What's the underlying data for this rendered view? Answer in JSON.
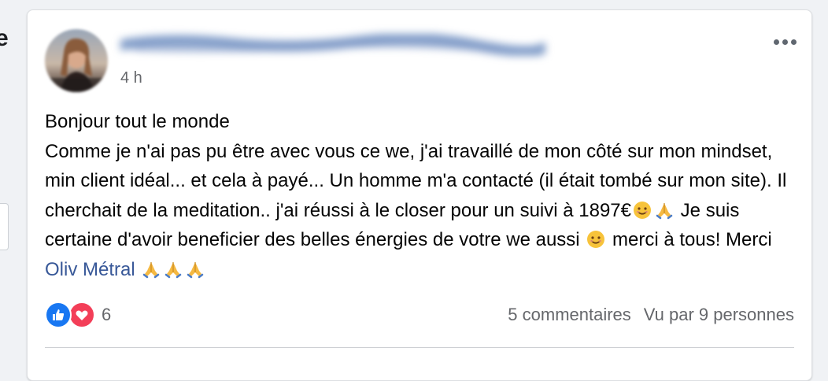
{
  "page_edge": {
    "left_letter": "e"
  },
  "post": {
    "timestamp": "4 h",
    "body_lines": [
      {
        "text": "Bonjour tout le monde"
      },
      {
        "text": "Comme je n'ai pas pu être avec vous ce we, j'ai travaillé de mon côté sur mon mindset, min client idéal... et cela à payé... Un homme m'a contacté (il était tombé sur mon site). Il cherchait de la meditation.. j'ai réussi à le closer pour un suivi à 1897€"
      },
      {
        "text_after_emoji": "Je suis certaine d'avoir beneficier des belles énergies de votre we aussi"
      },
      {
        "text_after_smile": "merci à tous! Merci"
      },
      {
        "mention": "Oliv Métral"
      }
    ],
    "reactions": {
      "icons": [
        "like-icon",
        "love-icon"
      ],
      "count": "6"
    },
    "stats": {
      "comments": "5 commentaires",
      "seen_by": "Vu par 9 personnes"
    }
  },
  "colors": {
    "like": "#1877f2",
    "love": "#f33e58",
    "mention": "#385898",
    "meta": "#65676b"
  }
}
